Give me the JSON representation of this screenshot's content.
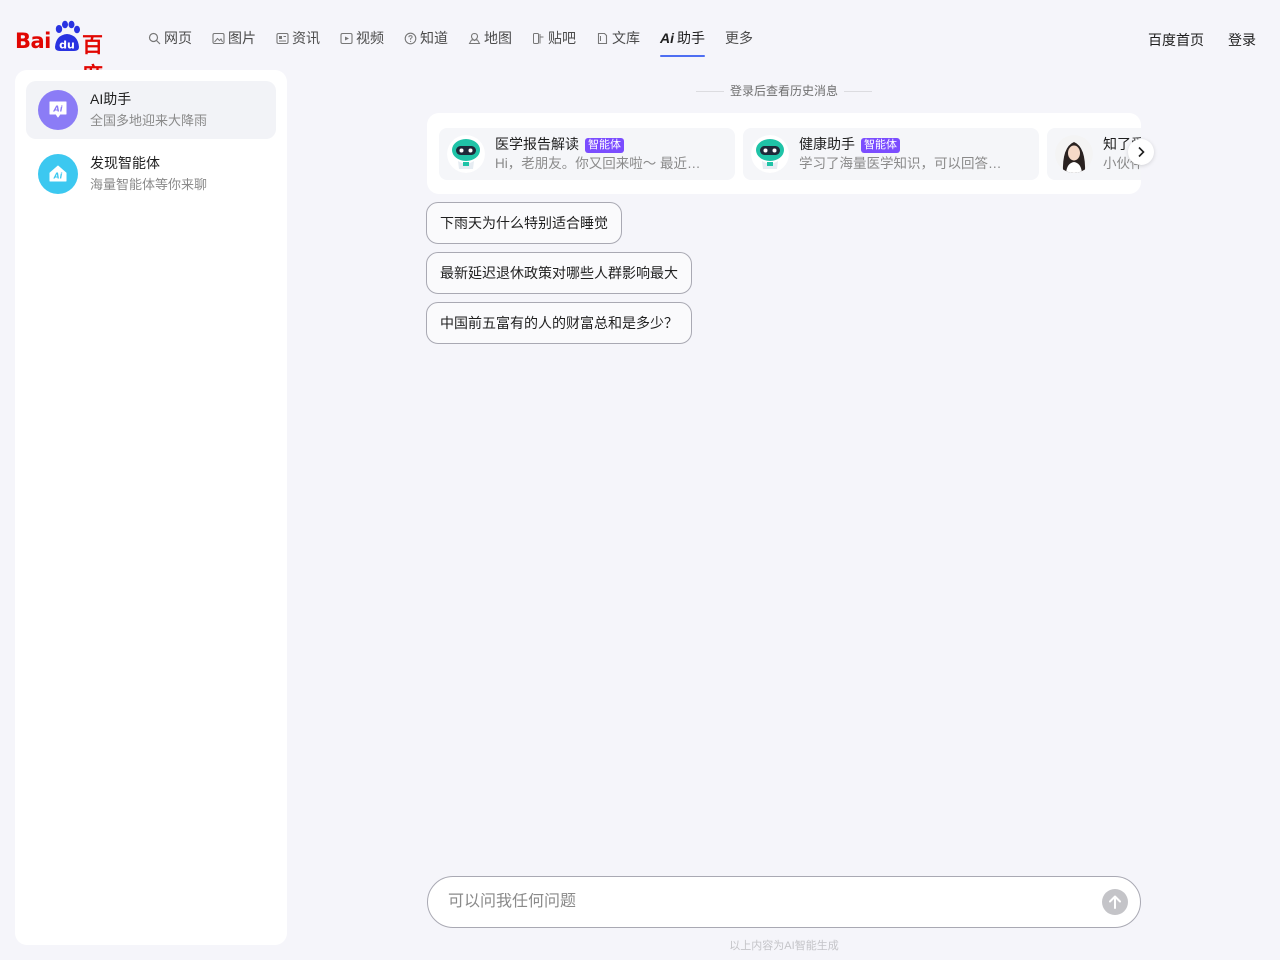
{
  "header": {
    "logo_left": "Bai",
    "logo_mid": "du",
    "logo_right": "百度",
    "nav": [
      {
        "label": "网页",
        "icon": "search-icon"
      },
      {
        "label": "图片",
        "icon": "image-icon"
      },
      {
        "label": "资讯",
        "icon": "news-icon"
      },
      {
        "label": "视频",
        "icon": "video-icon"
      },
      {
        "label": "知道",
        "icon": "question-icon"
      },
      {
        "label": "地图",
        "icon": "map-icon"
      },
      {
        "label": "贴吧",
        "icon": "tieba-icon"
      },
      {
        "label": "文库",
        "icon": "document-icon"
      },
      {
        "label": "助手",
        "icon": "ai-icon",
        "active": true
      },
      {
        "label": "更多"
      }
    ],
    "home_link": "百度首页",
    "login_link": "登录"
  },
  "sidebar": {
    "items": [
      {
        "title": "AI助手",
        "subtitle": "全国多地迎来大降雨",
        "icon": "ai-chat-icon",
        "color": "#8b7cf6"
      },
      {
        "title": "发现智能体",
        "subtitle": "海量智能体等你来聊",
        "icon": "ai-home-icon",
        "color": "#3cc8f0"
      }
    ]
  },
  "main": {
    "history_note": "登录后查看历史消息",
    "agents": [
      {
        "name": "医学报告解读",
        "badge": "智能体",
        "desc": "Hi，老朋友。你又回来啦～ 最近…"
      },
      {
        "name": "健康助手",
        "badge": "智能体",
        "desc": "学习了海量医学知识，可以回答…"
      },
      {
        "name": "知了爱",
        "desc": "小伙伴"
      }
    ],
    "suggestions": [
      "下雨天为什么特别适合睡觉",
      "最新延迟退休政策对哪些人群影响最大",
      "中国前五富有的人的财富总和是多少？"
    ],
    "input_placeholder": "可以问我任何问题",
    "footer_note": "以上内容为AI智能生成"
  },
  "colors": {
    "brand_red": "#e10602",
    "brand_blue": "#2932e1",
    "accent": "#4e6ef2",
    "badge": "#7b4dff"
  }
}
